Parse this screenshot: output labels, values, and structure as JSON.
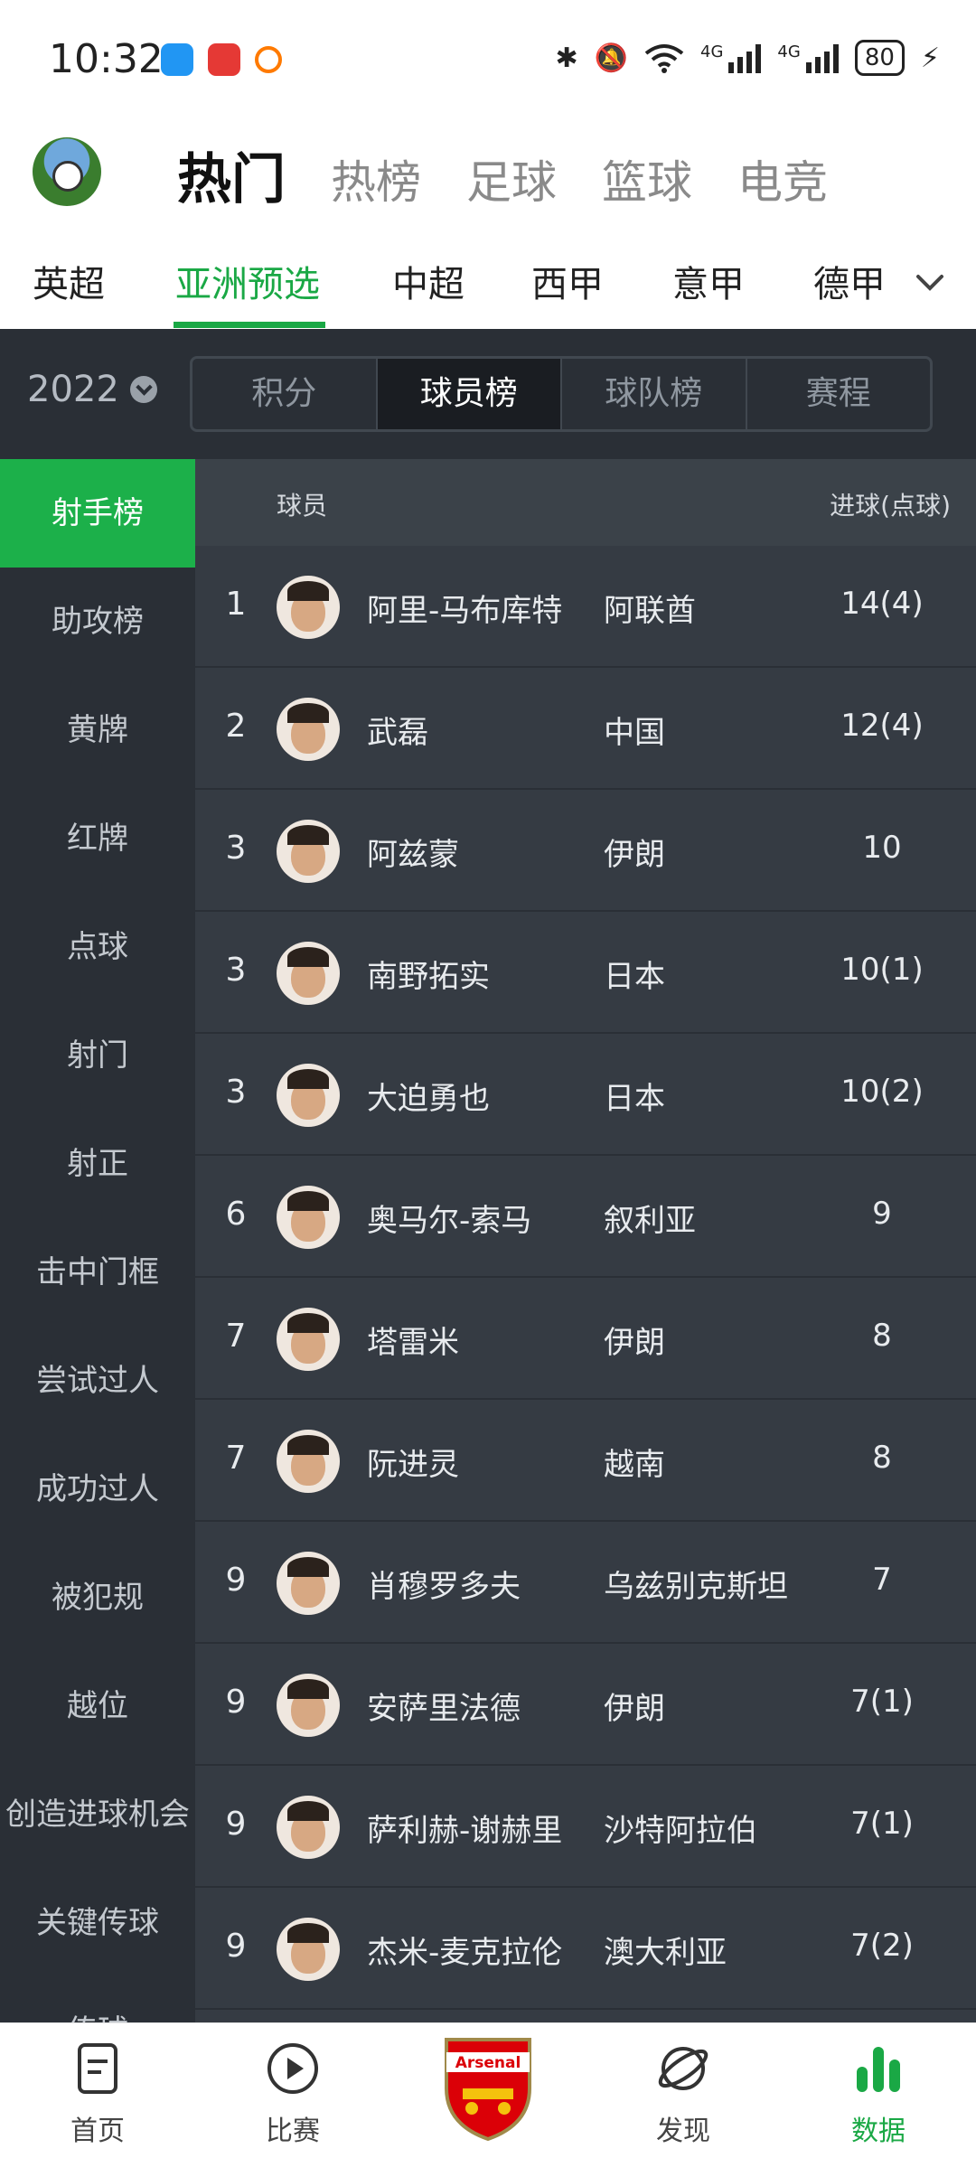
{
  "status": {
    "time": "10:32",
    "signal1": "4G",
    "signal2": "4G",
    "battery": "80"
  },
  "header": {
    "tabs": [
      "热门",
      "热榜",
      "足球",
      "篮球",
      "电竞"
    ],
    "active_tab": "热门"
  },
  "leagues": {
    "tabs": [
      "英超",
      "亚洲预选",
      "中超",
      "西甲",
      "意甲",
      "德甲"
    ],
    "active": "亚洲预选"
  },
  "filters": {
    "year": "2022",
    "segments": [
      "积分",
      "球员榜",
      "球队榜",
      "赛程"
    ],
    "active_segment": "球员榜"
  },
  "sidebar": {
    "items": [
      "射手榜",
      "助攻榜",
      "黄牌",
      "红牌",
      "点球",
      "射门",
      "射正",
      "击中门框",
      "尝试过人",
      "成功过人",
      "被犯规",
      "越位",
      "创造进球机会",
      "关键传球",
      "传球"
    ],
    "active": "射手榜"
  },
  "table": {
    "headers": {
      "player": "球员",
      "goals": "进球(点球)"
    },
    "rows": [
      {
        "rank": "1",
        "name": "阿里-马布库特",
        "country": "阿联酋",
        "goals": "14(4)"
      },
      {
        "rank": "2",
        "name": "武磊",
        "country": "中国",
        "goals": "12(4)"
      },
      {
        "rank": "3",
        "name": "阿兹蒙",
        "country": "伊朗",
        "goals": "10"
      },
      {
        "rank": "3",
        "name": "南野拓实",
        "country": "日本",
        "goals": "10(1)"
      },
      {
        "rank": "3",
        "name": "大迫勇也",
        "country": "日本",
        "goals": "10(2)"
      },
      {
        "rank": "6",
        "name": "奥马尔-索马",
        "country": "叙利亚",
        "goals": "9"
      },
      {
        "rank": "7",
        "name": "塔雷米",
        "country": "伊朗",
        "goals": "8"
      },
      {
        "rank": "7",
        "name": "阮进灵",
        "country": "越南",
        "goals": "8"
      },
      {
        "rank": "9",
        "name": "肖穆罗多夫",
        "country": "乌兹别克斯坦",
        "goals": "7"
      },
      {
        "rank": "9",
        "name": "安萨里法德",
        "country": "伊朗",
        "goals": "7(1)"
      },
      {
        "rank": "9",
        "name": "萨利赫-谢赫里",
        "country": "沙特阿拉伯",
        "goals": "7(1)"
      },
      {
        "rank": "9",
        "name": "杰米-麦克拉伦",
        "country": "澳大利亚",
        "goals": "7(2)"
      }
    ]
  },
  "bottom_nav": {
    "items": [
      {
        "label": "首页",
        "icon": "document-icon"
      },
      {
        "label": "比赛",
        "icon": "play-icon"
      },
      {
        "label": "",
        "icon": "arsenal-crest-icon"
      },
      {
        "label": "发现",
        "icon": "planet-icon"
      },
      {
        "label": "数据",
        "icon": "bar-chart-icon"
      }
    ],
    "crest_text": "Arsenal",
    "active": "数据"
  },
  "colors": {
    "accent": "#1aa845",
    "dark_bg": "#2a2f36",
    "table_bg": "#353b43"
  }
}
